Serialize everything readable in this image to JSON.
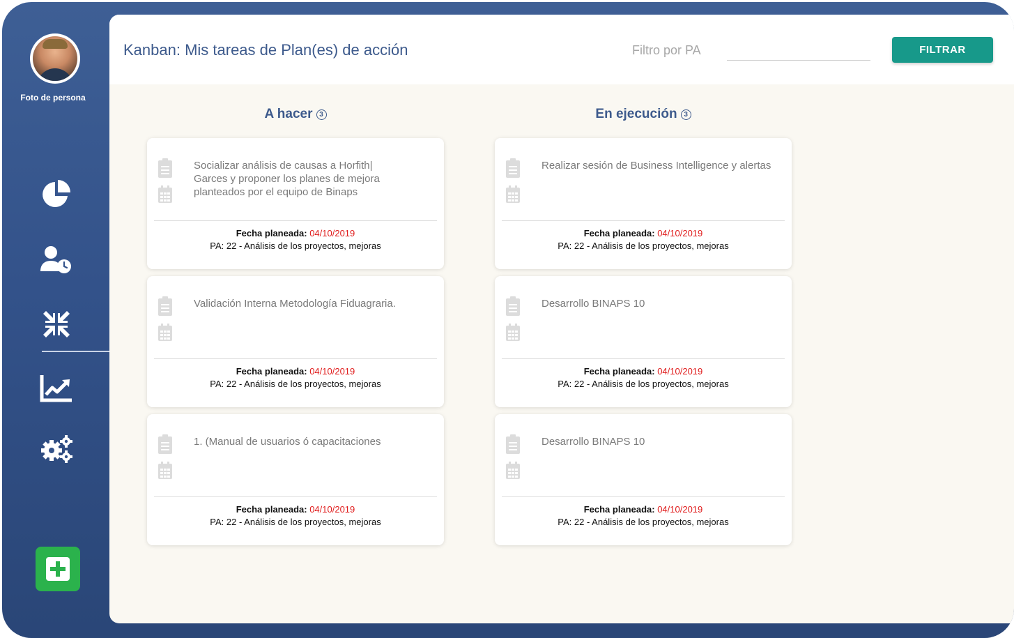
{
  "app": {
    "title": "Kanban: Mis tareas de Plan(es) de acción"
  },
  "profile": {
    "caption": "Foto de persona"
  },
  "sidebar": {
    "items": [
      {
        "icon": "pie-chart-icon"
      },
      {
        "icon": "user-clock-icon"
      },
      {
        "icon": "compress-arrows-icon",
        "active": true
      },
      {
        "icon": "chart-line-icon"
      },
      {
        "icon": "gears-icon"
      }
    ],
    "add_icon": "plus-square-icon",
    "add_color": "#2bb24c"
  },
  "filter": {
    "label": "Filtro por PA",
    "value": "",
    "button_label": "FILTRAR",
    "button_color": "#17998a"
  },
  "colors": {
    "accent": "#3d5a8c",
    "date_value": "#e01b1b",
    "background": "#faf8f2"
  },
  "columns": [
    {
      "title": "A hacer",
      "count": "3",
      "cards": [
        {
          "title": "Socializar análisis de causas a Horfith| Garces y proponer los planes de mejora planteados por el equipo de Binaps",
          "date_label": "Fecha planeada:",
          "date": "04/10/2019",
          "pa": "PA: 22 - Análisis de los proyectos, mejoras"
        },
        {
          "title": "Validación Interna Metodología Fiduagraria.",
          "date_label": "Fecha planeada:",
          "date": "04/10/2019",
          "pa": "PA: 22 - Análisis de los proyectos, mejoras"
        },
        {
          "title": "1. (Manual de usuarios ó capacitaciones",
          "date_label": "Fecha planeada:",
          "date": "04/10/2019",
          "pa": "PA: 22 - Análisis de los proyectos, mejoras"
        }
      ]
    },
    {
      "title": "En ejecución",
      "count": "3",
      "cards": [
        {
          "title": "Realizar sesión de Business Intelligence y alertas",
          "date_label": "Fecha planeada:",
          "date": "04/10/2019",
          "pa": "PA: 22 - Análisis de los proyectos, mejoras"
        },
        {
          "title": "Desarrollo BINAPS 10",
          "date_label": "Fecha planeada:",
          "date": "04/10/2019",
          "pa": "PA: 22 - Análisis de los proyectos, mejoras"
        },
        {
          "title": "Desarrollo BINAPS 10",
          "date_label": "Fecha planeada:",
          "date": "04/10/2019",
          "pa": "PA: 22 - Análisis de los proyectos, mejoras"
        }
      ]
    }
  ]
}
